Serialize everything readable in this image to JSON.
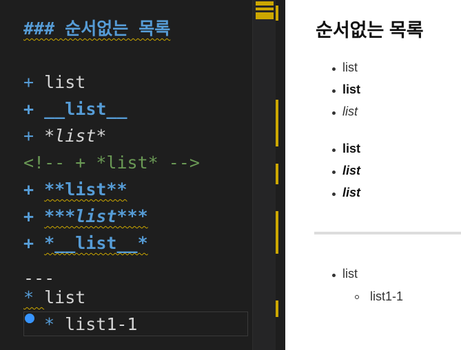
{
  "editor": {
    "lines": [
      {
        "text": "### 순서없는 목록"
      },
      {
        "prefix": "+ ",
        "text": "list"
      },
      {
        "prefix": "+ ",
        "text": "__list__"
      },
      {
        "prefix": "+ ",
        "text": "*list*"
      },
      {
        "text": "<!-- + *list* -->"
      },
      {
        "prefix": "+ ",
        "text": "**list**"
      },
      {
        "prefix": "+ ",
        "text": "***list***"
      },
      {
        "prefix": "+ ",
        "text": "*__list__*"
      },
      {
        "text": "---"
      },
      {
        "prefix": "* ",
        "text": "list"
      },
      {
        "prefix": "* ",
        "text": "list1-1"
      }
    ]
  },
  "preview": {
    "title": "순서없는 목록",
    "items": [
      "list",
      "list",
      "list",
      "list",
      "list",
      "list",
      "list",
      "list1-1"
    ]
  },
  "colors": {
    "accent": "#cca700",
    "markdown_blue": "#569cd6",
    "comment": "#6a9955"
  }
}
